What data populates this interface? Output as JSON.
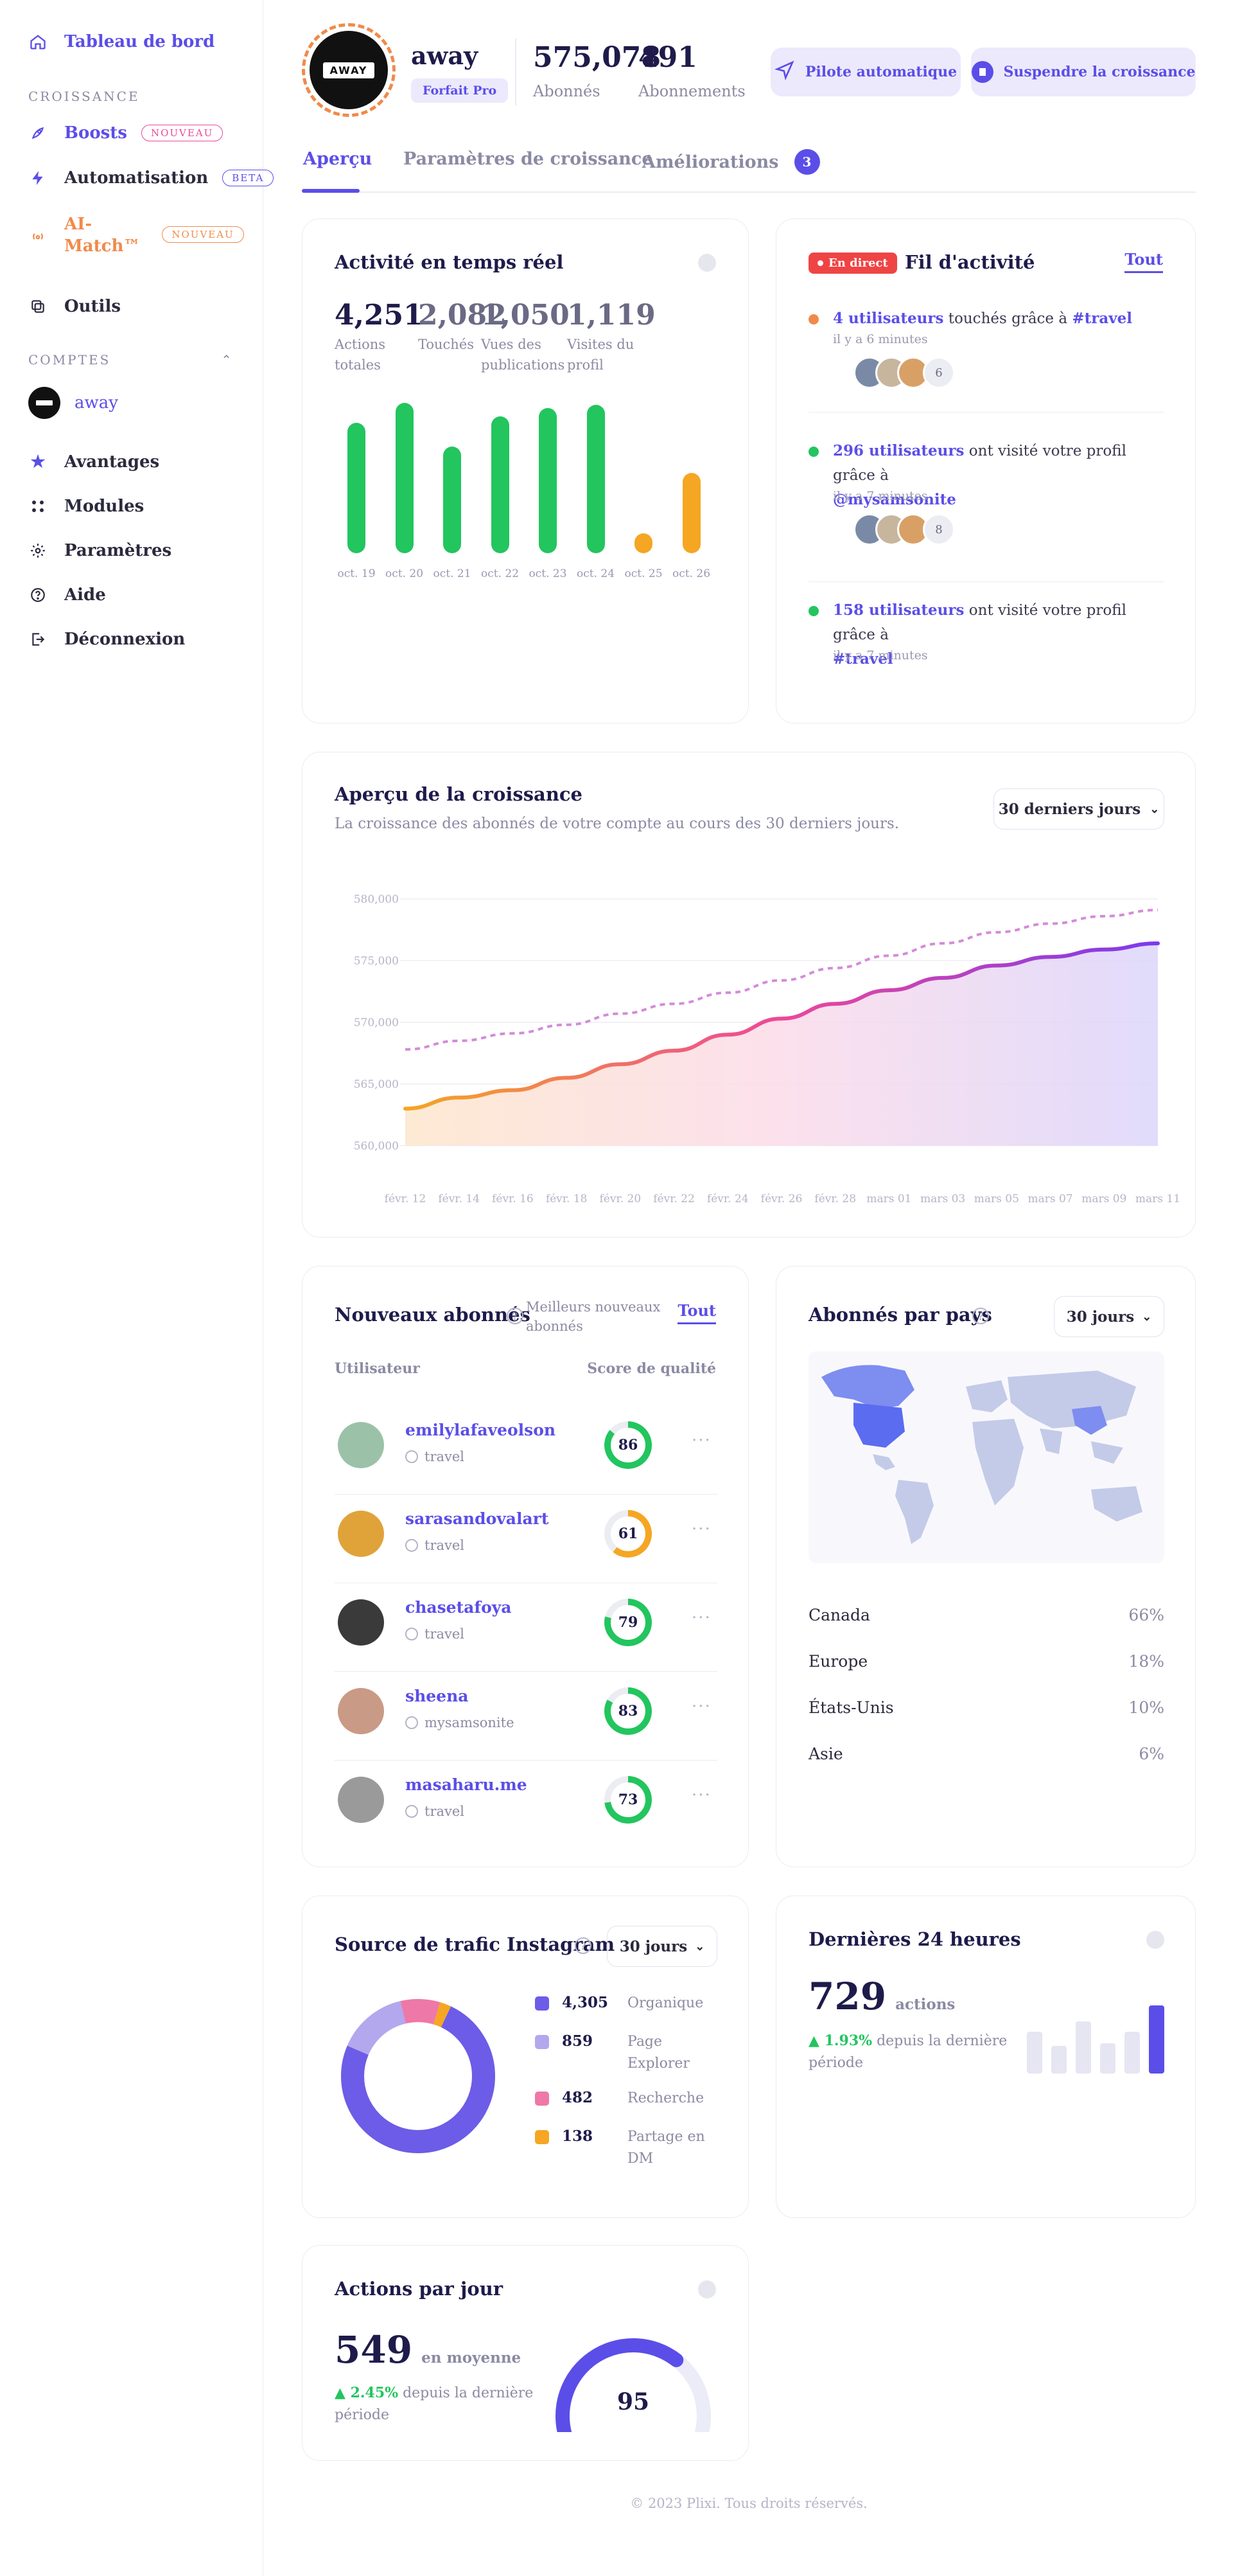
{
  "sidebar": {
    "dashboard": "Tableau de bord",
    "section_growth": "CROISSANCE",
    "boosts": "Boosts",
    "boosts_badge": "NOUVEAU",
    "automation": "Automatisation",
    "automation_badge": "BETA",
    "ai_match_1": "AI-",
    "ai_match_2": "Match™",
    "ai_match_badge": "NOUVEAU",
    "tools": "Outils",
    "section_accounts": "COMPTES",
    "account_name": "away",
    "advantages": "Avantages",
    "modules": "Modules",
    "settings": "Paramètres",
    "help": "Aide",
    "logout": "Déconnexion"
  },
  "header": {
    "logo_text": "AWAY",
    "account_name": "away",
    "plan": "Forfait Pro",
    "followers_value": "575,078",
    "followers_label": "Abonnés",
    "following_value": "491",
    "following_label": "Abonnements",
    "autopilot_button": "Pilote automatique",
    "pause_button": "Suspendre la croissance"
  },
  "tabs": {
    "overview": "Aperçu",
    "growth_settings": "Paramètres de croissance",
    "improvements": "Améliorations",
    "improvements_count": "3"
  },
  "activity": {
    "title": "Activité en temps réel",
    "stats": [
      {
        "value": "4,251",
        "label1": "Actions",
        "label2": "totales"
      },
      {
        "value": "2,082",
        "label1": "Touchés",
        "label2": ""
      },
      {
        "value": "1,050",
        "label1": "Vues des",
        "label2": "publications"
      },
      {
        "value": "1,119",
        "label1": "Visites du",
        "label2": "profil"
      }
    ],
    "bars": [
      {
        "day": "oct. 19",
        "value": 0.78,
        "color": "#22c55e"
      },
      {
        "day": "oct. 20",
        "value": 0.9,
        "color": "#22c55e"
      },
      {
        "day": "oct. 21",
        "value": 0.64,
        "color": "#22c55e"
      },
      {
        "day": "oct. 22",
        "value": 0.82,
        "color": "#22c55e"
      },
      {
        "day": "oct. 23",
        "value": 0.87,
        "color": "#22c55e"
      },
      {
        "day": "oct. 24",
        "value": 0.89,
        "color": "#22c55e"
      },
      {
        "day": "oct. 25",
        "value": 0.12,
        "color": "#f5a623"
      },
      {
        "day": "oct. 26",
        "value": 0.48,
        "color": "#f5a623"
      }
    ]
  },
  "feed": {
    "live_badge": "En direct",
    "title": "Fil d'activité",
    "all_link": "Tout",
    "items": [
      {
        "dot": "#f08a4b",
        "strong": "4 utilisateurs",
        "text": " touchés grâce à ",
        "tag": "#travel",
        "time": "il y a 6 minutes",
        "more": "6"
      },
      {
        "dot": "#22c55e",
        "strong": "296 utilisateurs",
        "text": " ont visité votre profil grâce à",
        "tag": "@mysamsonite",
        "time": "il y a 7 minutes",
        "more": "8"
      },
      {
        "dot": "#22c55e",
        "strong": "158 utilisateurs",
        "text": " ont visité votre profil grâce à",
        "tag": "#travel",
        "time": "il y a 7 minutes",
        "more": ""
      }
    ]
  },
  "growth": {
    "title": "Aperçu de la croissance",
    "subtitle": "La croissance des abonnés de votre compte au cours des 30 derniers jours.",
    "range": "30 derniers jours"
  },
  "chart_data": {
    "type": "area",
    "title": "Aperçu de la croissance",
    "x": [
      "févr. 12",
      "févr. 14",
      "févr. 16",
      "févr. 18",
      "févr. 20",
      "févr. 22",
      "févr. 24",
      "févr. 26",
      "févr. 28",
      "mars 01",
      "mars 03",
      "mars 05",
      "mars 07",
      "mars 09",
      "mars 11"
    ],
    "yticks": [
      "580,000",
      "575,000",
      "570,000",
      "565,000",
      "560,000"
    ],
    "ylim": [
      560000,
      580000
    ],
    "series": [
      {
        "values": [
          563000,
          563900,
          564500,
          565500,
          566600,
          567700,
          569000,
          570300,
          571500,
          572600,
          573600,
          574600,
          575300,
          575900,
          576400
        ]
      },
      {
        "values": [
          567800,
          568500,
          569100,
          569800,
          570700,
          571500,
          572400,
          573400,
          574400,
          575400,
          576400,
          577300,
          578000,
          578600,
          579100
        ]
      }
    ]
  },
  "new_followers": {
    "title": "Nouveaux abonnés",
    "best_1": "Meilleurs nouveaux",
    "best_2": "abonnés",
    "all_link": "Tout",
    "col_user": "Utilisateur",
    "col_score": "Score de qualité",
    "rows": [
      {
        "name": "emilylafaveolson",
        "source": "travel",
        "score": "86",
        "pct": 0.86,
        "color": "#22c55e",
        "av": "#9bc2a8"
      },
      {
        "name": "sarasandovalart",
        "source": "travel",
        "score": "61",
        "pct": 0.61,
        "color": "#f5a623",
        "av": "#e0a33a"
      },
      {
        "name": "chasetafoya",
        "source": "travel",
        "score": "79",
        "pct": 0.79,
        "color": "#22c55e",
        "av": "#3a3a3a"
      },
      {
        "name": "sheena",
        "source": "mysamsonite",
        "score": "83",
        "pct": 0.83,
        "color": "#22c55e",
        "av": "#c99a86"
      },
      {
        "name": "masaharu.me",
        "source": "travel",
        "score": "73",
        "pct": 0.73,
        "color": "#22c55e",
        "av": "#9a9a9a"
      }
    ]
  },
  "countries": {
    "title": "Abonnés par pays",
    "range": "30 jours",
    "rows": [
      {
        "name": "Canada",
        "value": "66%"
      },
      {
        "name": "Europe",
        "value": "18%"
      },
      {
        "name": "États-Unis",
        "value": "10%"
      },
      {
        "name": "Asie",
        "value": "6%"
      }
    ]
  },
  "traffic": {
    "title": "Source de trafic Instagram",
    "range": "30 jours",
    "items": [
      {
        "value": "4,305",
        "label1": "Organique",
        "label2": "",
        "color": "#6c5ce7"
      },
      {
        "value": "859",
        "label1": "Page",
        "label2": "Explorer",
        "color": "#b3a7ee"
      },
      {
        "value": "482",
        "label1": "Recherche",
        "label2": "",
        "color": "#ee78a8"
      },
      {
        "value": "138",
        "label1": "Partage en",
        "label2": "DM",
        "color": "#f5a623"
      }
    ]
  },
  "last24": {
    "title": "Dernières 24 heures",
    "value": "729",
    "unit": "actions",
    "delta": "▲ 1.93%",
    "delta_text": "depuis la dernière",
    "delta_text2": "période",
    "bars": [
      0.58,
      0.38,
      0.72,
      0.42,
      0.58,
      0.95
    ]
  },
  "daily": {
    "title": "Actions par jour",
    "value": "549",
    "unit": "en moyenne",
    "delta": "▲ 2.45%",
    "delta_text": "depuis la dernière",
    "delta_text2": "période",
    "gauge_value": "95",
    "gauge_pct": 0.95
  },
  "footer": "© 2023 Plixi. Tous droits réservés."
}
